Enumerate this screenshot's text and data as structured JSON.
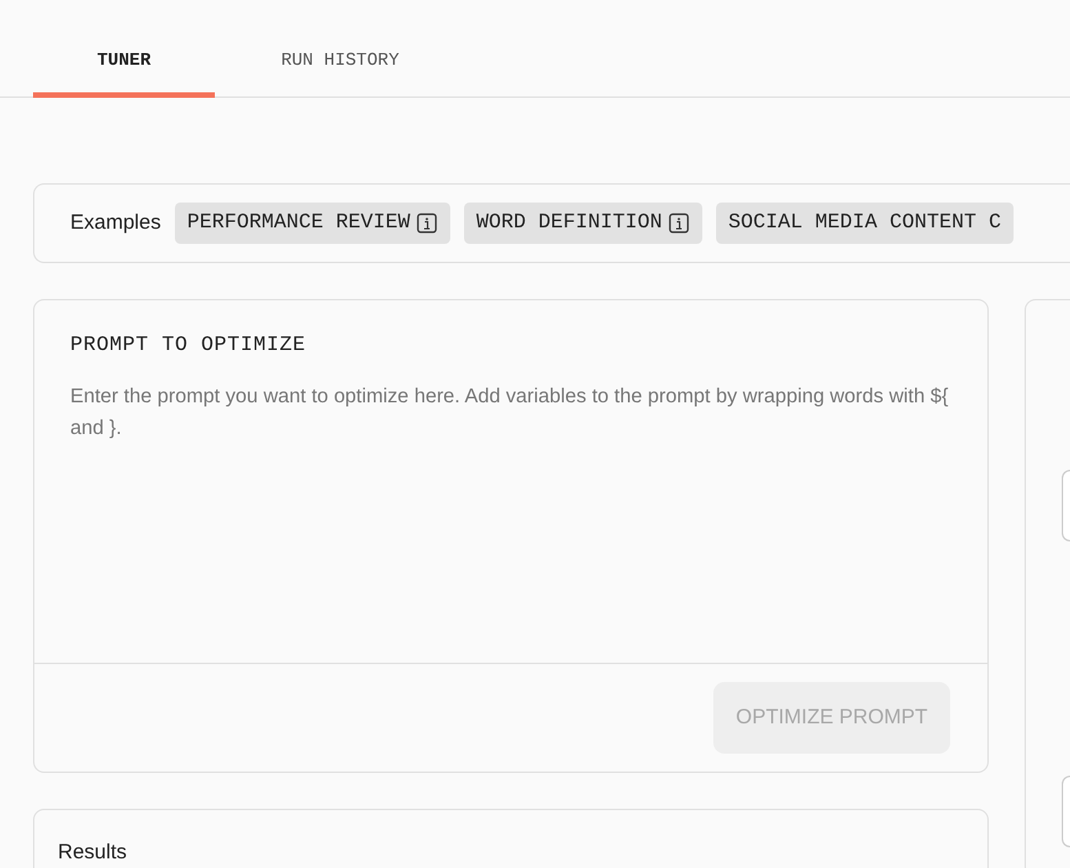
{
  "tabs": [
    {
      "label": "TUNER",
      "selected": true
    },
    {
      "label": "RUN HISTORY",
      "selected": false
    }
  ],
  "examples": {
    "label": "Examples",
    "chips": [
      {
        "label": "PERFORMANCE REVIEW",
        "info": true
      },
      {
        "label": "WORD DEFINITION",
        "info": true
      },
      {
        "label": "SOCIAL MEDIA CONTENT C",
        "info": false
      }
    ]
  },
  "prompt": {
    "title": "PROMPT TO OPTIMIZE",
    "placeholder": "Enter the prompt you want to optimize here. Add variables to the prompt by wrapping words with ${ and }.",
    "button": {
      "label": "OPTIMIZE PROMPT",
      "disabled": true
    }
  },
  "results": {
    "title": "Results"
  },
  "side_panel": {
    "items": [
      {
        "kind": "field"
      },
      {
        "kind": "field"
      }
    ]
  }
}
